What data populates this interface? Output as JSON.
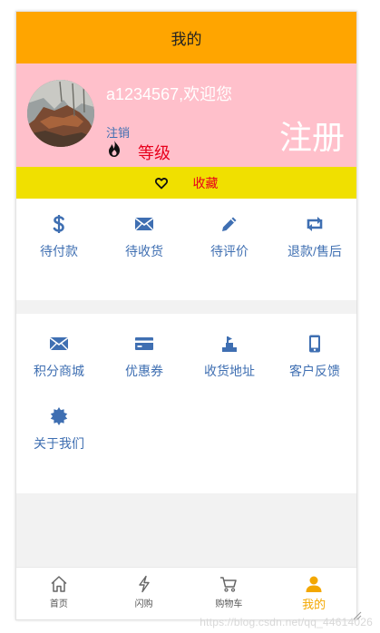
{
  "header": {
    "title": "我的"
  },
  "profile": {
    "welcome": "a1234567,欢迎您",
    "logout_label": "注销",
    "level_label": "等级",
    "register_label": "注册"
  },
  "favorites": {
    "label": "收藏"
  },
  "orders": {
    "items": [
      {
        "label": "待付款",
        "icon": "dollar-icon"
      },
      {
        "label": "待收货",
        "icon": "envelope-icon"
      },
      {
        "label": "待评价",
        "icon": "pencil-icon"
      },
      {
        "label": "退款/售后",
        "icon": "retweet-icon"
      }
    ]
  },
  "services": {
    "items": [
      {
        "label": "积分商城",
        "icon": "envelope-icon"
      },
      {
        "label": "优惠券",
        "icon": "credit-card-icon"
      },
      {
        "label": "收货地址",
        "icon": "map-pin-icon"
      },
      {
        "label": "客户反馈",
        "icon": "phone-icon"
      },
      {
        "label": "关于我们",
        "icon": "badge-icon"
      }
    ]
  },
  "tabbar": {
    "items": [
      {
        "label": "首页",
        "icon": "home-icon"
      },
      {
        "label": "闪购",
        "icon": "lightning-icon"
      },
      {
        "label": "购物车",
        "icon": "cart-icon"
      },
      {
        "label": "我的",
        "icon": "user-icon",
        "active": true
      }
    ]
  },
  "watermark": "https://blog.csdn.net/qq_44614026",
  "colors": {
    "titlebar": "#ffa500",
    "profile_bg": "#ffc0cb",
    "favbar_bg": "#f0e000",
    "icon_blue": "#3f6fb2",
    "accent_red": "#e8001c",
    "tab_active": "#f3a700"
  }
}
